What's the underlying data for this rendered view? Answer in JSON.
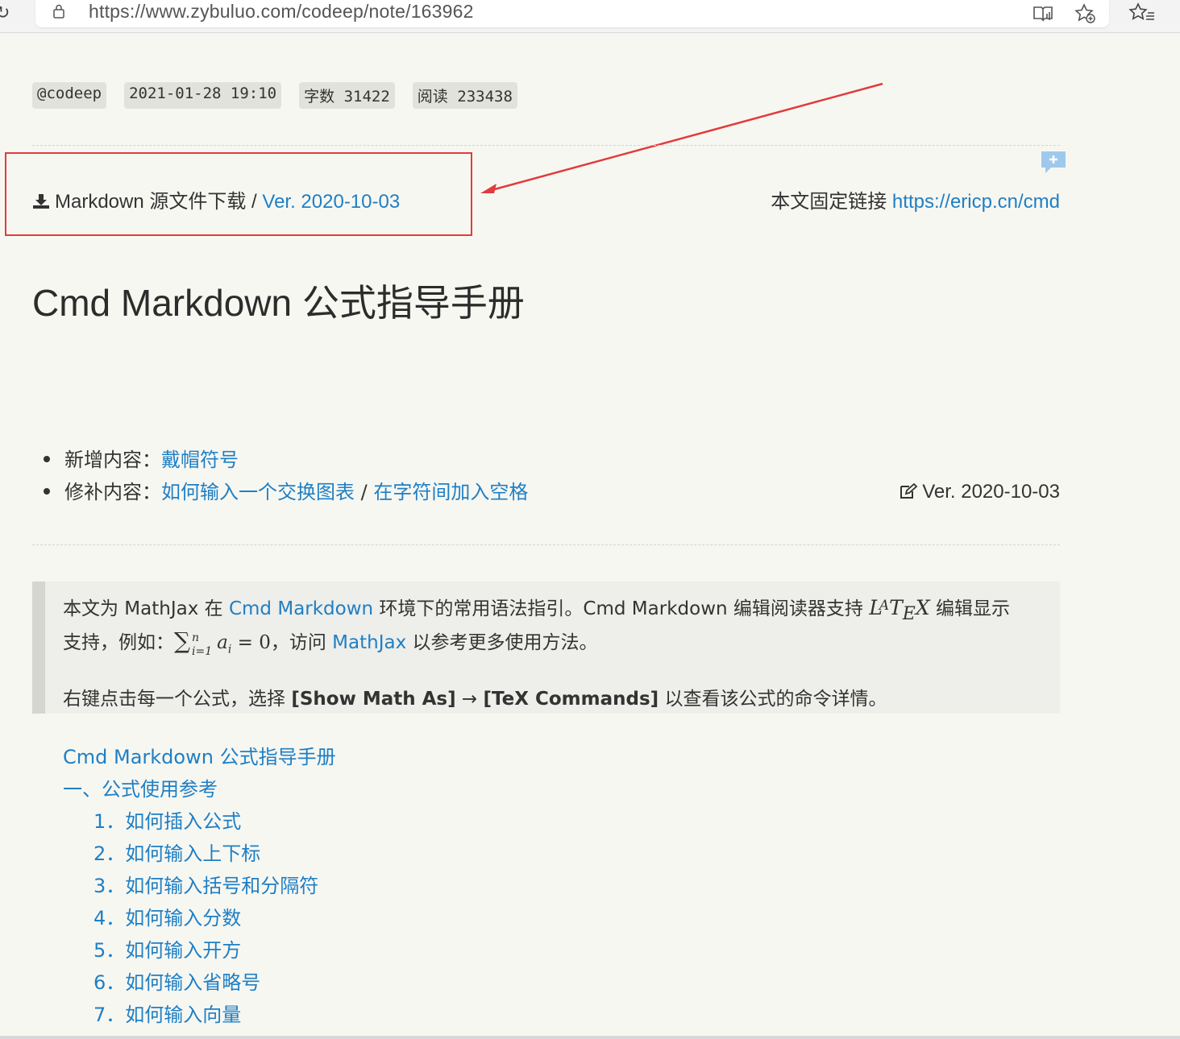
{
  "browser": {
    "url": "https://www.zybuluo.com/codeep/note/163962"
  },
  "meta": {
    "author": "@codeep",
    "datetime": "2021-01-28 19:10",
    "word_count_label": "字数",
    "word_count": "31422",
    "read_label": "阅读",
    "read_count": "233438"
  },
  "download": {
    "label": "Markdown 源文件下载",
    "separator": " / ",
    "version_link": "Ver. 2020-10-03"
  },
  "permalink": {
    "label": "本文固定链接",
    "url": "https://ericp.cn/cmd"
  },
  "title": "Cmd Markdown 公式指导手册",
  "updates": {
    "added_label": "新增内容：",
    "added_link": "戴帽符号",
    "revised_label": "修补内容：",
    "revised_link_1": "如何输入一个交换图表",
    "revised_separator": " / ",
    "revised_link_2": "在字符间加入空格",
    "version_note": "Ver. 2020-10-03"
  },
  "intro": {
    "p1_a": "本文为 MathJax 在 ",
    "p1_link": "Cmd Markdown",
    "p1_b": " 环境下的常用语法指引。Cmd Markdown 编辑阅读器支持 ",
    "latex_l": "L",
    "latex_a": "A",
    "latex_t": "T",
    "latex_e": "E",
    "latex_x": "X",
    "p1_c": " 编辑显示",
    "p1_d": "支持，例如：",
    "sum": "∑",
    "sum_upper": "n",
    "sum_lower": "i=1",
    "formula_var": "a",
    "formula_sub": "i",
    "formula_eq": " = 0",
    "p1_e": "，访问 ",
    "p1_link2": "MathJax",
    "p1_f": " 以参考更多使用方法。",
    "p2_a": "右键点击每一个公式，选择 ",
    "p2_b1": "[Show Math As]",
    "p2_arrow": " → ",
    "p2_b2": "[TeX Commands]",
    "p2_c": " 以查看该公式的命令详情。"
  },
  "toc": {
    "root": "Cmd Markdown 公式指导手册",
    "section1": "一、公式使用参考",
    "items": [
      "1．如何插入公式",
      "2．如何输入上下标",
      "3．如何输入括号和分隔符",
      "4．如何输入分数",
      "5．如何输入开方",
      "6．如何输入省略号",
      "7．如何输入向量"
    ]
  },
  "colors": {
    "link": "#1f7fc4",
    "highlight": "#e23b3b",
    "page_bg": "#f7f7f2"
  }
}
